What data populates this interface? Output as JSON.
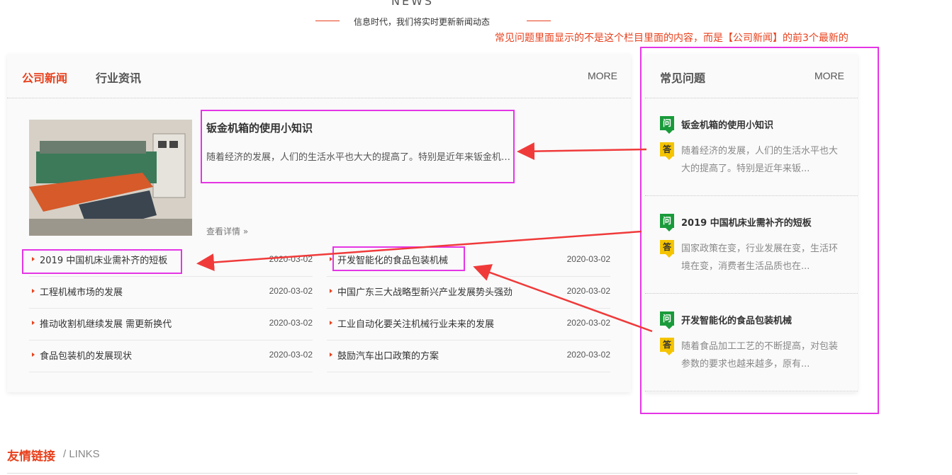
{
  "header": {
    "title_en": "NEWS",
    "subtitle": "信息时代，我们将实时更新新闻动态"
  },
  "annotation": {
    "text": "常见问题里面显示的不是这个栏目里面的内容，而是【公司新闻】的前3个最新的",
    "color": "#e8401c",
    "box_color": "#e535e5",
    "arrow_color": "#f03a3a"
  },
  "news_panel": {
    "tabs": [
      {
        "label": "公司新闻",
        "active": true
      },
      {
        "label": "行业资讯",
        "active": false
      }
    ],
    "more_label": "MORE",
    "featured": {
      "image_icon": "machine-photo",
      "title": "钣金机箱的使用小知识",
      "desc": "随着经济的发展，人们的生活水平也大大的提高了。特别是近年来钣金机箱的应用越来越广泛",
      "more_label": "查看详情 »"
    },
    "left_list": [
      {
        "title": "2019 中国机床业需补齐的短板",
        "date": "2020-03-02"
      },
      {
        "title": "工程机械市场的发展",
        "date": "2020-03-02"
      },
      {
        "title": "推动收割机继续发展 需更新换代",
        "date": "2020-03-02"
      },
      {
        "title": "食品包装机的发展现状",
        "date": "2020-03-02"
      }
    ],
    "right_list": [
      {
        "title": "开发智能化的食品包装机械",
        "date": "2020-03-02"
      },
      {
        "title": "中国广东三大战略型新兴产业发展势头强劲",
        "date": "2020-03-02"
      },
      {
        "title": "工业自动化要关注机械行业未来的发展",
        "date": "2020-03-02"
      },
      {
        "title": "鼓励汽车出口政策的方案",
        "date": "2020-03-02"
      }
    ]
  },
  "faq_panel": {
    "title": "常见问题",
    "more_label": "MORE",
    "q_badge": "问",
    "a_badge": "答",
    "items": [
      {
        "q": "钣金机箱的使用小知识",
        "a": "随着经济的发展，人们的生活水平也大大的提高了。特别是近年来钣..."
      },
      {
        "q": "2019 中国机床业需补齐的短板",
        "a": "国家政策在变，行业发展在变，生活环境在变，消费者生活品质也在..."
      },
      {
        "q": "开发智能化的食品包装机械",
        "a": "随着食品加工工艺的不断提高，对包装参数的要求也越来越多，原有..."
      }
    ]
  },
  "links": {
    "title": "友情链接",
    "subtitle": "/ LINKS"
  }
}
